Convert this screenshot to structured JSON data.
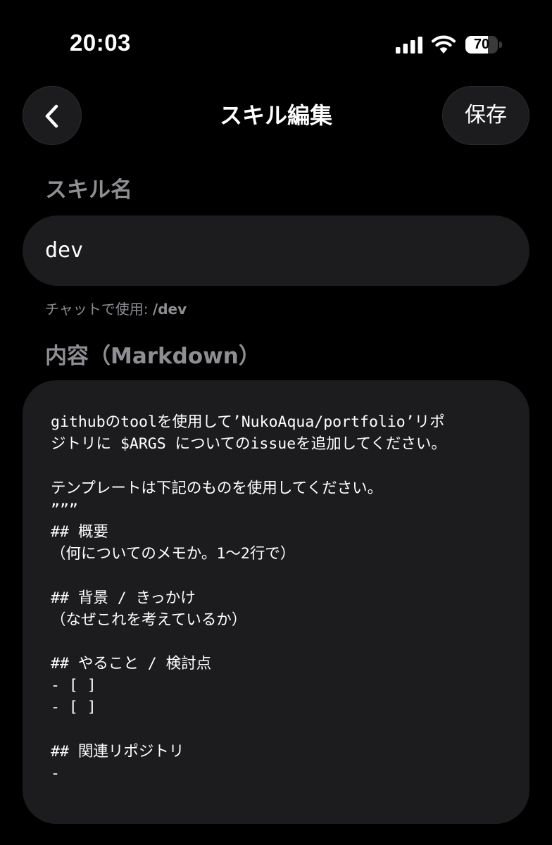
{
  "status_bar": {
    "time": "20:03",
    "battery_level": "70",
    "battery_fraction": 0.7,
    "icons": [
      "cellular-signal-icon",
      "wifi-icon",
      "battery-icon"
    ]
  },
  "nav": {
    "back_icon": "chevron-left-icon",
    "title": "スキル編集",
    "save_label": "保存"
  },
  "skill_name": {
    "label": "スキル名",
    "value": "dev",
    "usage_prefix": "チャットで使用: ",
    "usage_command": "/dev"
  },
  "content": {
    "label": "内容（Markdown）",
    "lines": [
      "githubのtoolを使用して’NukoAqua/portfolio’リポ",
      "ジトリに $ARGS についてのissueを追加してください。",
      "",
      "テンプレートは下記のものを使用してください。",
      "”””",
      "## 概要",
      "（何についてのメモか。1〜2行で）",
      "",
      "## 背景 / きっかけ",
      "（なぜこれを考えているか）",
      "",
      "## やること / 検討点",
      "- [ ]",
      "- [ ]",
      "",
      "## 関連リポジトリ",
      "-"
    ]
  },
  "colors": {
    "background": "#000000",
    "surface": "#1c1c1e",
    "secondary_text": "#8e8e93",
    "primary_text": "#ffffff"
  }
}
